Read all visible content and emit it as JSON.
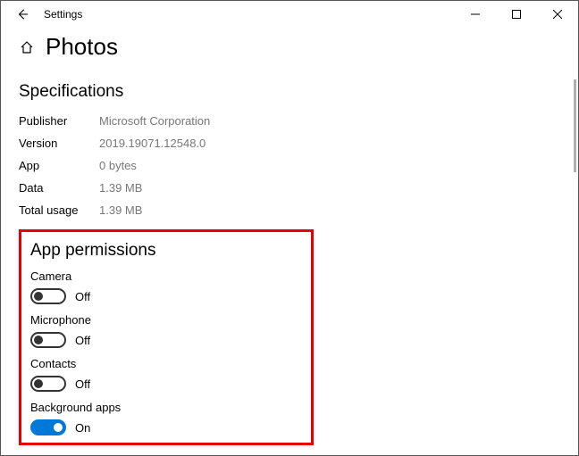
{
  "window": {
    "title": "Settings"
  },
  "page": {
    "title": "Photos"
  },
  "specifications": {
    "heading": "Specifications",
    "rows": [
      {
        "label": "Publisher",
        "value": "Microsoft Corporation"
      },
      {
        "label": "Version",
        "value": "2019.19071.12548.0"
      },
      {
        "label": "App",
        "value": "0 bytes"
      },
      {
        "label": "Data",
        "value": "1.39 MB"
      },
      {
        "label": "Total usage",
        "value": "1.39 MB"
      }
    ]
  },
  "permissions": {
    "heading": "App permissions",
    "items": [
      {
        "label": "Camera",
        "state": "Off",
        "on": false
      },
      {
        "label": "Microphone",
        "state": "Off",
        "on": false
      },
      {
        "label": "Contacts",
        "state": "Off",
        "on": false
      },
      {
        "label": "Background apps",
        "state": "On",
        "on": true
      }
    ]
  }
}
